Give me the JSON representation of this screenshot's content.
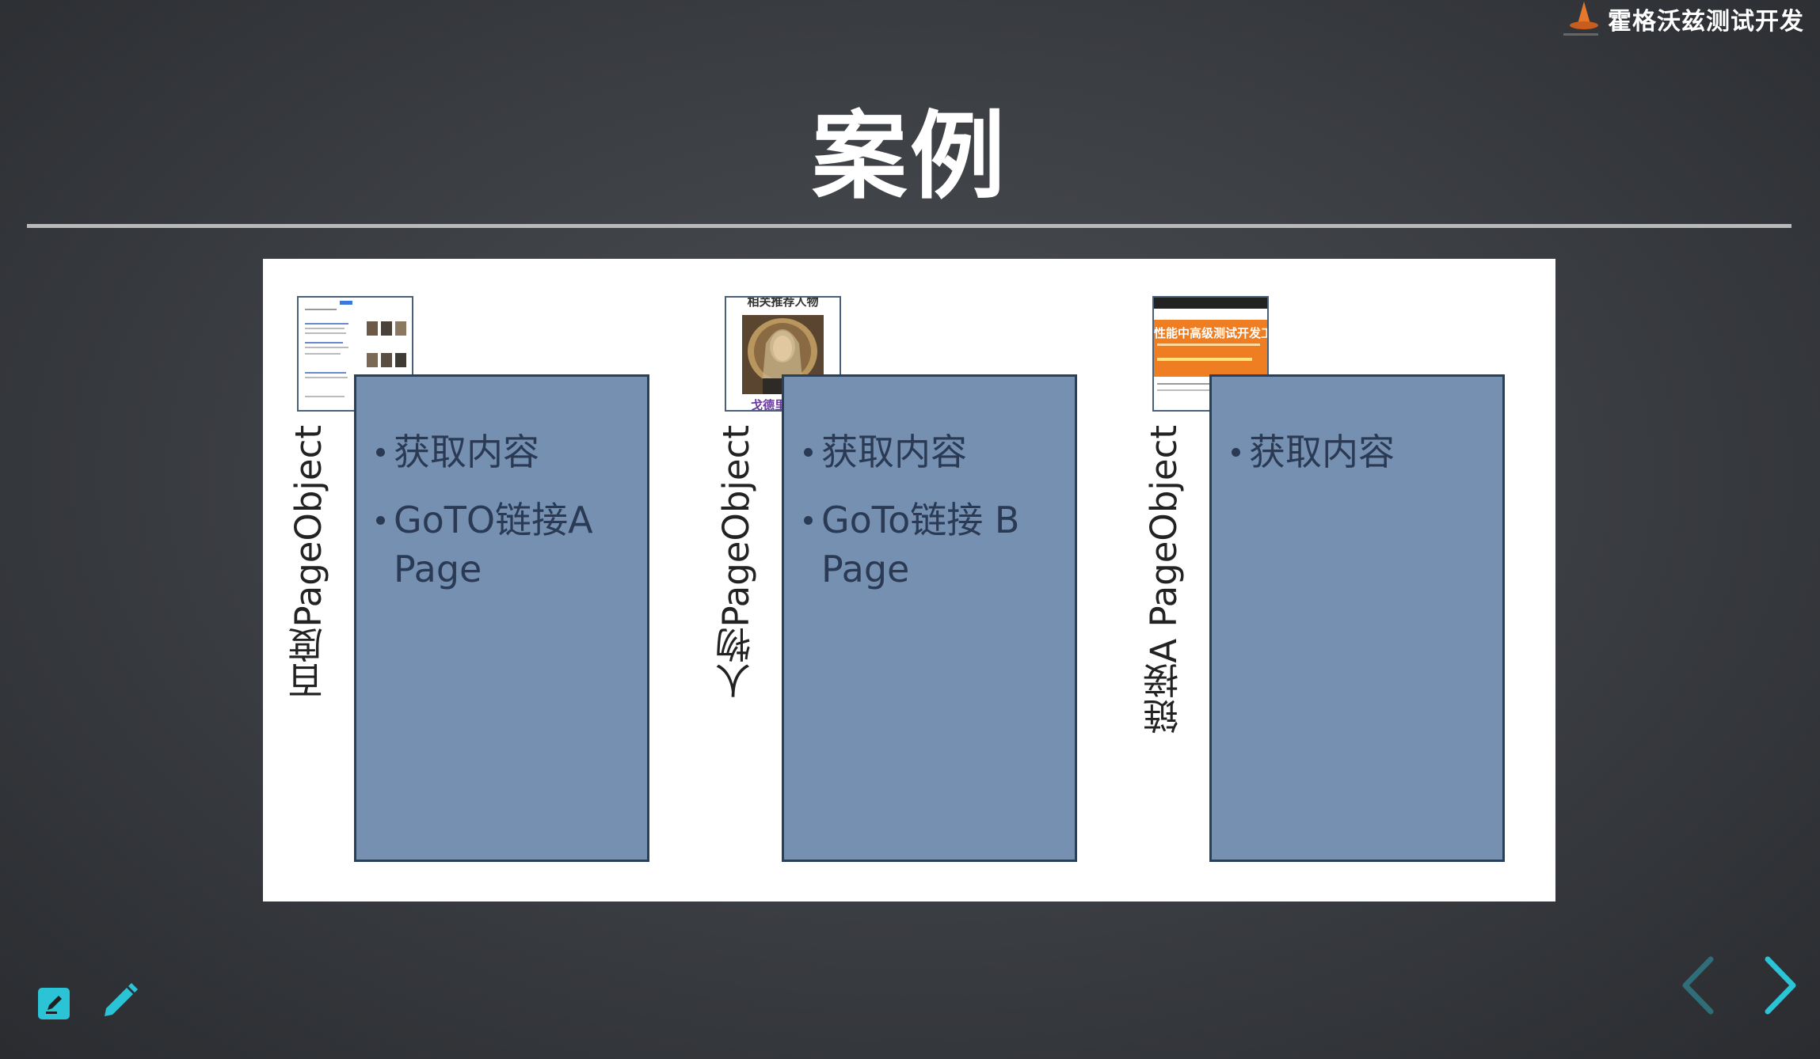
{
  "brand": {
    "name": "霍格沃兹测试开发"
  },
  "slide": {
    "title": "案例",
    "groups": [
      {
        "label": "百度PageObject",
        "thumbnail": "baidu-search-results-thumbnail",
        "items": [
          "获取内容",
          "GoTO链接A Page"
        ]
      },
      {
        "label": "人物PageObject",
        "thumbnail": "person-portrait-thumbnail",
        "thumb_text_top": "相关推荐人物",
        "thumb_text_bottom": "戈德里克·格",
        "items": [
          "获取内容",
          "GoTo链接 B Page"
        ]
      },
      {
        "label": "链接A PageObject",
        "thumbnail": "course-banner-thumbnail",
        "thumb_banner_text": "性能中高级测试开发工",
        "items": [
          "获取内容"
        ]
      }
    ]
  },
  "toolbar": {
    "icons": [
      "edit-note-icon",
      "pencil-icon"
    ]
  },
  "navigation": {
    "icons": [
      "chevron-left-icon",
      "chevron-right-icon"
    ]
  },
  "colors": {
    "panel": "#7690b1",
    "accent": "#2bc3d6",
    "background": "#3d4045"
  }
}
